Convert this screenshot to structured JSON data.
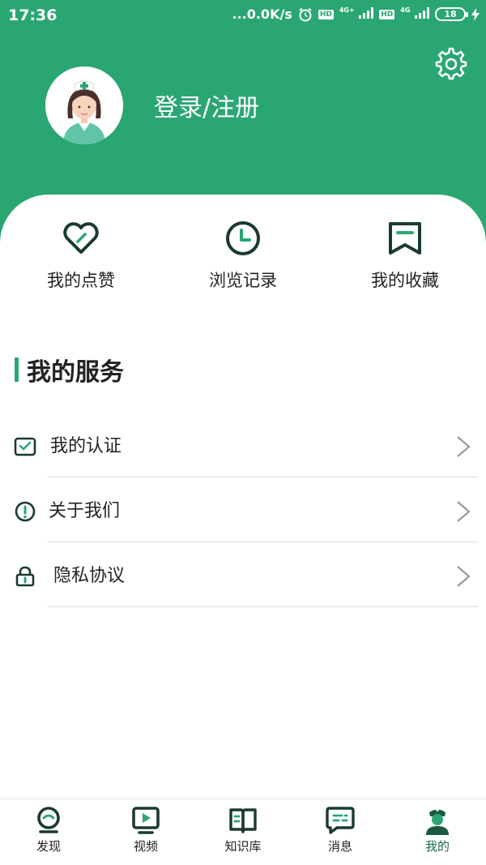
{
  "status_bar": {
    "time": "17:36",
    "speed": "...0.0K/s",
    "net1": "4G+",
    "net2": "4G",
    "hd": "HD",
    "battery": "18"
  },
  "header": {
    "login_label": "登录/注册",
    "accent_color": "#2aa673"
  },
  "quick_actions": [
    {
      "label": "我的点赞",
      "icon": "heart-icon"
    },
    {
      "label": "浏览记录",
      "icon": "clock-icon"
    },
    {
      "label": "我的收藏",
      "icon": "bookmark-icon"
    }
  ],
  "services": {
    "title": "我的服务",
    "items": [
      {
        "label": "我的认证",
        "icon": "certification-icon"
      },
      {
        "label": "关于我们",
        "icon": "info-icon"
      },
      {
        "label": "隐私协议",
        "icon": "lock-icon"
      }
    ]
  },
  "tabbar": {
    "items": [
      {
        "label": "发现",
        "icon": "discover-icon"
      },
      {
        "label": "视频",
        "icon": "video-icon"
      },
      {
        "label": "知识库",
        "icon": "knowledge-icon"
      },
      {
        "label": "消息",
        "icon": "message-icon"
      },
      {
        "label": "我的",
        "icon": "profile-nurse-icon",
        "active": true
      }
    ]
  }
}
